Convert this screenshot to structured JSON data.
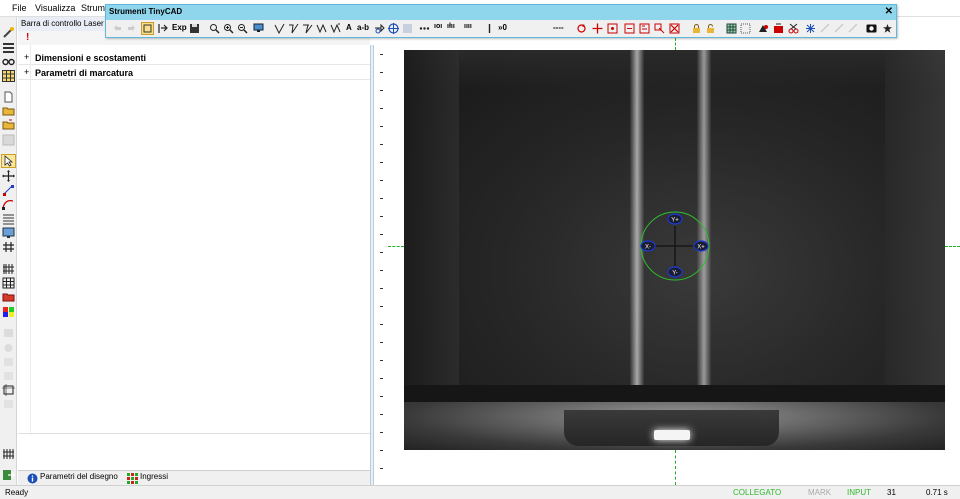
{
  "menu": {
    "items": [
      "File",
      "Visualizza",
      "Strume"
    ]
  },
  "panel": {
    "title": "Barra di controllo Laser",
    "tree": [
      {
        "expander": "+",
        "label": "Dimensioni e scostamenti"
      },
      {
        "expander": "+",
        "label": "Parametri di marcatura"
      }
    ],
    "tabs": [
      {
        "label": "Parametri del disegno",
        "icon": "info-icon"
      },
      {
        "label": "Ingressi",
        "icon": "io-grid-icon"
      }
    ]
  },
  "tinycad": {
    "title": "Strumenti TinyCAD",
    "close": "✕",
    "exp_label": "Exp",
    "text_labels": {
      "a": "A",
      "ab": "a-b",
      "barcode_a": "ıııı",
      "counter": "»0",
      "dots": "----",
      "code1": "ıoı",
      "code2": "ıłıı"
    }
  },
  "camera": {
    "markers": {
      "top": "Y+",
      "bottom": "Y-",
      "left": "X-",
      "right": "X+"
    }
  },
  "status": {
    "ready": "Ready",
    "connected": "COLLEGATO",
    "mark": "MARK",
    "input": "INPUT",
    "number": "31",
    "time": "0.71 s"
  },
  "colors": {
    "connected": "#2eb82e",
    "guide": "#22b022",
    "marker": "#1a3ad0"
  },
  "icons": {
    "left_toolbar": [
      "wand-icon",
      "lines-icon",
      "glasses-icon",
      "grid-icon",
      "new-doc-icon",
      "open-folder-icon",
      "open-folder2-icon",
      "save-disabled-icon",
      "pointer-icon",
      "move-icon",
      "node-icon",
      "bezier-icon",
      "list-icon",
      "monitor-icon",
      "hash-icon",
      "barcode-grid-icon",
      "grid2-icon",
      "folder-red-icon",
      "palette-icon",
      "disabled-1-icon",
      "disabled-2-icon",
      "disabled-3-icon",
      "disabled-4-icon",
      "frame-icon",
      "disabled-5-icon",
      "grid-cut-icon",
      "exit-icon"
    ]
  }
}
